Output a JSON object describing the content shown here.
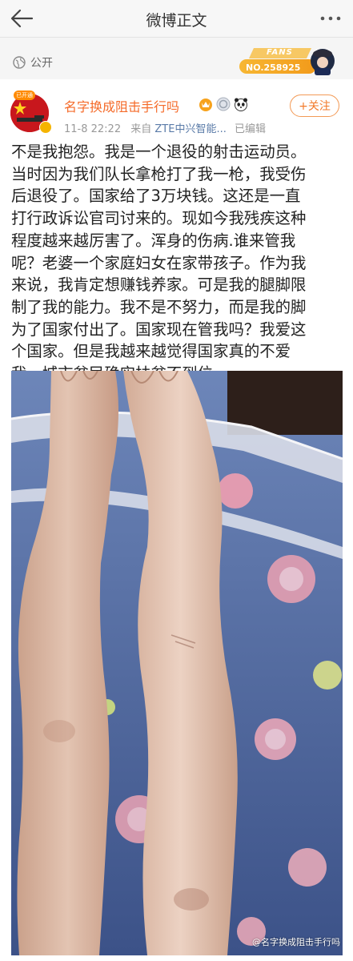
{
  "nav": {
    "title": "微博正文",
    "back_icon": "back-arrow-icon",
    "more_icon": "more-dots-icon"
  },
  "visibility": {
    "label": "公开",
    "icon": "globe-icon"
  },
  "fans_badge": {
    "word": "FANS",
    "number": "NO.258925"
  },
  "author": {
    "name": "名字换成阻击手行吗",
    "avatar_tag": "已开通",
    "time": "11-8 22:22",
    "source_prefix": "来自",
    "source": "ZTE中兴智能...",
    "edited": "已编辑",
    "follow_label": "+关注",
    "badge_icons": [
      "crown-icon",
      "medal-icon",
      "panda-icon"
    ]
  },
  "post": {
    "lines": [
      "不是我抱怨。我是一个退役的射击运动员。",
      "当时因为我们队长拿枪打了我一枪，我受伤",
      "后退役了。国家给了3万块钱。这还是一直",
      "打行政诉讼官司讨来的。现如今我残疾这种",
      "程度越来越厉害了。浑身的伤病.谁来管我",
      "呢？老婆一个家庭妇女在家带孩子。作为我",
      "来说，我肯定想赚钱养家。可是我的腿脚限",
      "制了我的能力。我不是不努力，而是我的脚",
      "为了国家付出了。国家现在管我吗？我爱这",
      "个国家。但是我越来越觉得国家真的不爱",
      "我。城市贫民确实扶贫不到位。"
    ]
  },
  "photo": {
    "watermark": "@名字换成阻击手行吗"
  },
  "colors": {
    "accent_orange": "#f56b2a",
    "link_blue": "#5a7ba8",
    "meta_gray": "#999999"
  }
}
